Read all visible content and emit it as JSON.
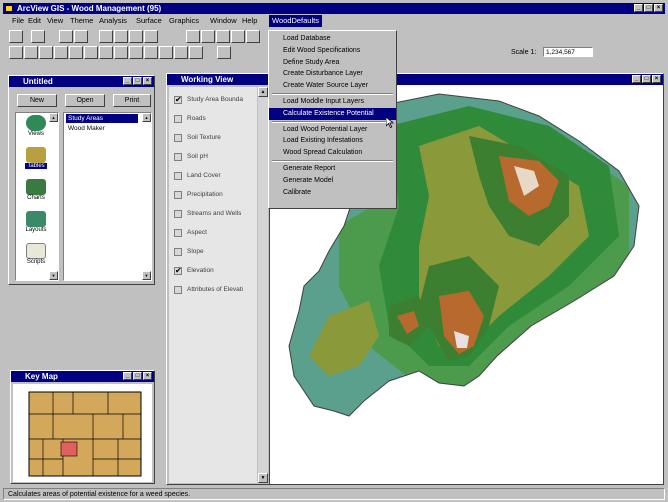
{
  "app": {
    "title": "ArcView GIS - Wood Management (95)"
  },
  "menubar": {
    "items": [
      "File",
      "Edit",
      "View",
      "Theme",
      "Analysis",
      "Surface",
      "Graphics",
      "Window",
      "Help",
      "WoodDefaults"
    ]
  },
  "toolbar": {
    "scale_label": "Scale 1:",
    "scale_value": "1,234,567"
  },
  "dropdown": {
    "items": [
      {
        "label": "Load Database",
        "sep_after": false,
        "selected": false
      },
      {
        "label": "Edit Wood Specifications",
        "sep_after": false,
        "selected": false
      },
      {
        "label": "Define Study Area",
        "sep_after": false,
        "selected": false
      },
      {
        "label": "Create Disturbance Layer",
        "sep_after": false,
        "selected": false
      },
      {
        "label": "Create Water Source Layer",
        "sep_after": true,
        "selected": false
      },
      {
        "label": "Load Moddle Input Layers",
        "sep_after": false,
        "selected": false
      },
      {
        "label": "Calculate Existence Potential",
        "sep_after": true,
        "selected": true
      },
      {
        "label": "Load Wood Potential Layer",
        "sep_after": false,
        "selected": false
      },
      {
        "label": "Load Existing Infestations",
        "sep_after": false,
        "selected": false
      },
      {
        "label": "Wood Spread Calculation",
        "sep_after": true,
        "selected": false
      },
      {
        "label": "Generate Report",
        "sep_after": false,
        "selected": false
      },
      {
        "label": "Generate Model",
        "sep_after": false,
        "selected": false
      },
      {
        "label": "Calibrate",
        "sep_after": false,
        "selected": false
      }
    ]
  },
  "project": {
    "title": "Untitled",
    "buttons": [
      "New",
      "Open",
      "Print"
    ],
    "icons": [
      {
        "label": "Views",
        "color": "#2e8b57"
      },
      {
        "label": "Tables",
        "color": "#b8a040"
      },
      {
        "label": "Charts",
        "color": "#3a7a40"
      },
      {
        "label": "Layouts",
        "color": "#3a8a6a"
      },
      {
        "label": "Scripts",
        "color": "#e8e8d8"
      }
    ],
    "selected_icon": "Tables",
    "list": [
      "Study Areas",
      "Wood Maker"
    ]
  },
  "working_view": {
    "title": "Working View",
    "themes": [
      {
        "label": "Study Area Bounda",
        "checked": true
      },
      {
        "label": "Roads",
        "checked": false
      },
      {
        "label": "Soil Texture",
        "checked": false
      },
      {
        "label": "Soil pH",
        "checked": false
      },
      {
        "label": "Land Cover",
        "checked": false
      },
      {
        "label": "Precipitation",
        "checked": false
      },
      {
        "label": "Streams and Wells",
        "checked": false
      },
      {
        "label": "Aspect",
        "checked": false
      },
      {
        "label": "Slope",
        "checked": false
      },
      {
        "label": "Elevation",
        "checked": true
      },
      {
        "label": "Attributes of Elevati",
        "checked": false
      }
    ]
  },
  "key_map": {
    "title": "Key Map"
  },
  "status_bar": {
    "text": "Calculates areas of potential existence for a weed species."
  },
  "colors": {
    "title_bar": "#000080",
    "menu_selected": "#000080",
    "desktop": "#c0c0c0"
  },
  "icons": [
    "app-icon",
    "minimize-icon",
    "maximize-icon",
    "close-icon",
    "check-icon",
    "scroll-up-icon",
    "scroll-down-icon"
  ]
}
